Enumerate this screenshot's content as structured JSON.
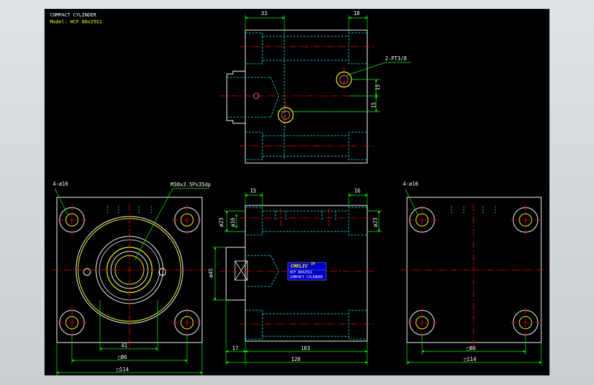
{
  "title_block": {
    "line1": "COMPACT CYLINDER",
    "line2": "Model: HCF 80x25S1"
  },
  "callouts": {
    "ports": "2-PT3/8",
    "holes_left": "4-ø16",
    "holes_right": "4-ø16",
    "thread": "M30x3.5Px35dp"
  },
  "dims": {
    "top_33": "33",
    "top_18": "18",
    "top_15a": "15",
    "top_15b": "15",
    "side_15": "15",
    "side_16": "16",
    "side_d23a": "ø23",
    "side_d16": "ø16",
    "side_d23b": "ø23",
    "side_d45": "ø45",
    "side_17": "17",
    "side_103": "103",
    "side_120": "120",
    "front_41": "41",
    "front_86": "□86",
    "front_114": "□114",
    "back_86": "□86",
    "back_114": "□114"
  },
  "nameplate": {
    "brand": "CHELIC",
    "sup": "TP",
    "model": "HCF 80X25S1",
    "desc": "COMPACT CYLINDER"
  },
  "colors": {
    "outline": "#ffffff",
    "hidden": "#00ffff",
    "center": "#ff0000",
    "dimension": "#00ff00",
    "text": "#ffffff",
    "highlight": "#ffff00",
    "plate": "#0000c8"
  }
}
